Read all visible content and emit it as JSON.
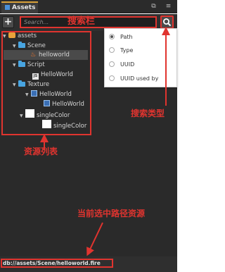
{
  "panel": {
    "tab_title": "Assets",
    "toolbar": {
      "add_label": "+",
      "search_placeholder": "Search..."
    },
    "tree": [
      {
        "label": "assets",
        "icon": "assets-folder-icon",
        "depth": 0,
        "expanded": true
      },
      {
        "label": "Scene",
        "icon": "folder-icon",
        "depth": 1,
        "expanded": true
      },
      {
        "label": "helloworld",
        "icon": "fire-icon",
        "depth": 2,
        "selected": true
      },
      {
        "label": "Script",
        "icon": "folder-icon",
        "depth": 1,
        "expanded": true
      },
      {
        "label": "HelloWorld",
        "icon": "js-file-icon",
        "depth": 2
      },
      {
        "label": "Texture",
        "icon": "folder-icon",
        "depth": 1,
        "expanded": true
      },
      {
        "label": "HelloWorld",
        "icon": "image-icon",
        "depth": 2,
        "expanded": true
      },
      {
        "label": "HelloWorld",
        "icon": "sprite-icon",
        "depth": 3
      },
      {
        "label": "singleColor",
        "icon": "white-texture-icon",
        "depth": 2,
        "expanded": true
      },
      {
        "label": "singleColor",
        "icon": "white-sprite-icon",
        "depth": 3
      }
    ],
    "path_bar": {
      "path": "db://assets/Scene/helloworld.fire"
    },
    "search_type_menu": {
      "options": [
        {
          "label": "Path",
          "selected": true
        },
        {
          "label": "Type",
          "selected": false
        },
        {
          "label": "UUID",
          "selected": false
        },
        {
          "label": "UUID used by",
          "selected": false
        }
      ]
    }
  },
  "annotations": {
    "search_bar": "搜索栏",
    "search_type": "搜索类型",
    "asset_list": "资源列表",
    "current_path": "当前选中路径资源"
  },
  "colors": {
    "annotation_red": "#e0342f",
    "folder_blue": "#48a4e0",
    "panel_bg": "#2a2a2a"
  }
}
